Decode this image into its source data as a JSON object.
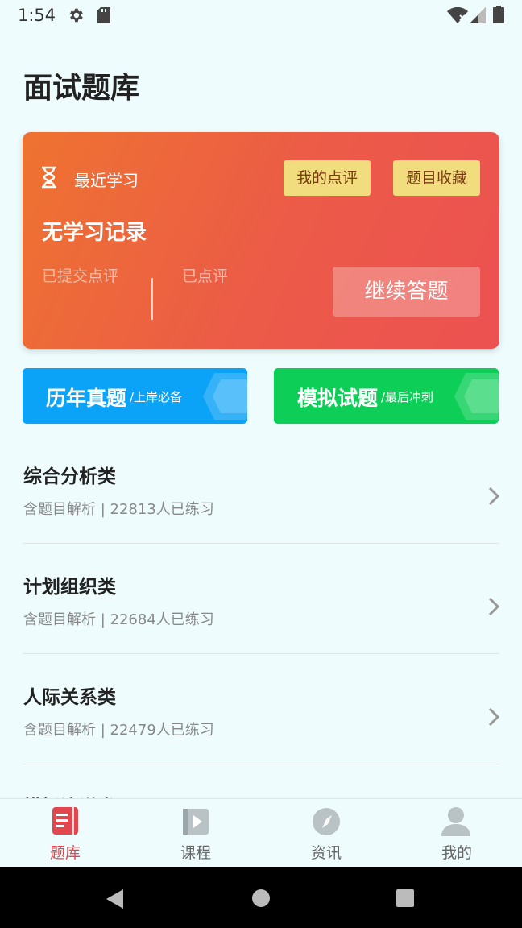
{
  "status_bar": {
    "time": "1:54"
  },
  "page": {
    "title": "面试题库"
  },
  "recent": {
    "label": "最近学习",
    "my_review_btn": "我的点评",
    "favorites_btn": "题目收藏",
    "no_record": "无学习记录",
    "submitted_label": "已提交点评",
    "reviewed_label": "已点评",
    "continue_btn": "继续答题"
  },
  "banners": [
    {
      "title": "历年真题",
      "sub": "/上岸必备",
      "color": "#0aa3f7"
    },
    {
      "title": "模拟试题",
      "sub": "/最后冲刺",
      "color": "#0dcf58"
    }
  ],
  "categories": [
    {
      "title": "综合分析类",
      "meta": "含题目解析 | 22813人已练习"
    },
    {
      "title": "计划组织类",
      "meta": "含题目解析 | 22684人已练习"
    },
    {
      "title": "人际关系类",
      "meta": "含题目解析 | 22479人已练习"
    },
    {
      "title": "模拟演说类",
      "meta": ""
    }
  ],
  "bottom_nav": [
    {
      "label": "题库",
      "icon": "book-icon",
      "active": true
    },
    {
      "label": "课程",
      "icon": "video-icon",
      "active": false
    },
    {
      "label": "资讯",
      "icon": "compass-icon",
      "active": false
    },
    {
      "label": "我的",
      "icon": "user-icon",
      "active": false
    }
  ],
  "colors": {
    "accent": "#e2474d",
    "card_start": "#ee7330",
    "card_end": "#ec5151"
  }
}
